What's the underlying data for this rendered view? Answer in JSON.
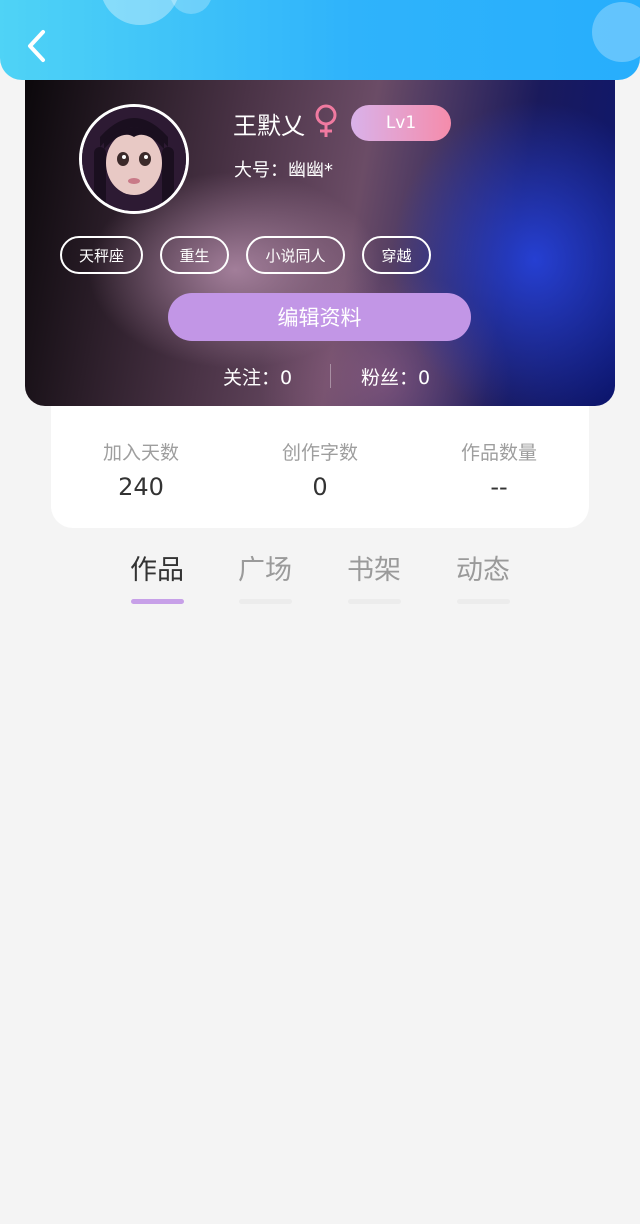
{
  "header": {
    "back_icon": "chevron-left-icon"
  },
  "profile": {
    "name": "王默乂",
    "gender": "♀",
    "level": "Lv1",
    "alias_label": "大号：",
    "alias_value": "幽幽*",
    "tags": [
      "天秤座",
      "重生",
      "小说同人",
      "穿越"
    ],
    "edit_label": "编辑资料",
    "follow_text": "关注：0",
    "fans_text": "粉丝：0"
  },
  "stats": [
    {
      "label": "加入天数",
      "value": "240"
    },
    {
      "label": "创作字数",
      "value": "0"
    },
    {
      "label": "作品数量",
      "value": "--"
    }
  ],
  "tabs": [
    {
      "label": "作品",
      "active": true
    },
    {
      "label": "广场",
      "active": false
    },
    {
      "label": "书架",
      "active": false
    },
    {
      "label": "动态",
      "active": false
    }
  ],
  "colors": {
    "header": "#2fb3fb",
    "accent": "#c296e6",
    "gender": "#f07aa0",
    "tab_indicator": "#c7a0e8"
  }
}
